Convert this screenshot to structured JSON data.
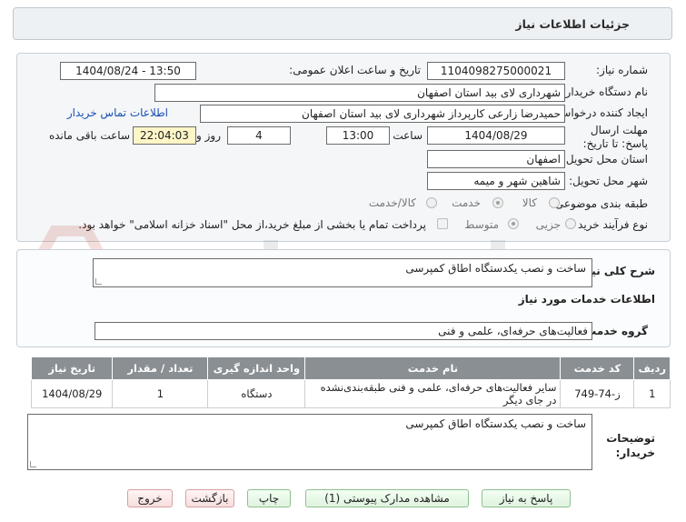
{
  "header": {
    "title": "جزئیات اطلاعات نیاز"
  },
  "form": {
    "need_number_label": "شماره نیاز:",
    "need_number": "1104098275000021",
    "announce_label": "تاریخ و ساعت اعلان عمومی:",
    "announce_value": "1404/08/24 - 13:50",
    "buyer_org_label": "نام دستگاه خریدار:",
    "buyer_org": "شهرداری لای بید استان اصفهان",
    "creator_label": "ایجاد کننده درخواست:",
    "creator": "حمیدرضا زارعی کارپرداز شهرداری لای بید استان اصفهان",
    "contact_link": "اطلاعات تماس خریدار",
    "deadline_label": "مهلت ارسال پاسخ: تا تاریخ:",
    "deadline_date": "1404/08/29",
    "time_label": "ساعت",
    "deadline_time": "13:00",
    "days_value": "4",
    "days_label": "روز و",
    "remaining_time": "22:04:03",
    "remaining_label": "ساعت باقی مانده",
    "province_label": "استان محل تحویل:",
    "province": "اصفهان",
    "city_label": "شهر محل تحویل:",
    "city": "شاهین شهر و میمه",
    "category_label": "طبقه بندی موضوعی:",
    "category_options": [
      "کالا",
      "خدمت",
      "کالا/خدمت"
    ],
    "process_label": "نوع فرآیند خرید :",
    "process_options": [
      "جزیی",
      "متوسط"
    ],
    "payment_note": "پرداخت تمام یا بخشی از مبلغ خرید،از محل \"اسناد خزانه اسلامی\" خواهد بود."
  },
  "description": {
    "label": "شرح کلی نیاز:",
    "value": "ساخت و نصب یکدستگاه اطاق کمپرسی"
  },
  "services": {
    "heading": "اطلاعات خدمات مورد نیاز",
    "group_label": "گروه خدمت:",
    "group_value": "فعالیت‌های حرفه‌ای، علمی و فنی",
    "columns": [
      "ردیف",
      "کد خدمت",
      "نام خدمت",
      "واحد اندازه گیری",
      "تعداد / مقدار",
      "تاریخ نیاز"
    ],
    "rows": [
      {
        "index": "1",
        "code": "ز-74-749",
        "name": "سایر فعالیت‌های حرفه‌ای، علمی و فنی طبقه‌بندی‌نشده در جای دیگر",
        "unit": "دستگاه",
        "qty": "1",
        "date": "1404/08/29"
      }
    ]
  },
  "buyer_notes": {
    "label": "توضیحات خریدار:",
    "value": "ساخت و نصب یکدستگاه اطاق کمپرسی"
  },
  "buttons": {
    "reply": "پاسخ به نیاز",
    "view_docs": "مشاهده مدارک پیوستی (1)",
    "print": "چاپ",
    "back": "بازگشت",
    "exit": "خروج"
  }
}
